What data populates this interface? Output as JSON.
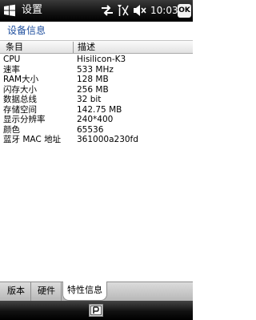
{
  "statusbar": {
    "title": "设置",
    "time": "10:03",
    "ok_label": "OK",
    "icons": [
      "windows-start-icon",
      "connectivity-icon",
      "signal-icon",
      "volume-muted-icon"
    ]
  },
  "page": {
    "title": "设备信息"
  },
  "table": {
    "headers": {
      "name": "条目",
      "value": "描述"
    },
    "rows": [
      {
        "name": "CPU",
        "value": "Hisilicon-K3"
      },
      {
        "name": "速率",
        "value": "533 MHz"
      },
      {
        "name": "RAM大小",
        "value": "128 MB"
      },
      {
        "name": "闪存大小",
        "value": "256 MB"
      },
      {
        "name": "数据总线",
        "value": "32 bit"
      },
      {
        "name": "存储空间",
        "value": "142.75 MB"
      },
      {
        "name": "显示分辨率",
        "value": "240*400"
      },
      {
        "name": "颜色",
        "value": "65536"
      },
      {
        "name": "蓝牙 MAC 地址",
        "value": "361000a230fd"
      }
    ]
  },
  "tabs": [
    {
      "label": "版本"
    },
    {
      "label": "硬件"
    },
    {
      "label": "特性信息"
    }
  ],
  "menubar": {
    "icon": "keyboard-input-icon"
  }
}
